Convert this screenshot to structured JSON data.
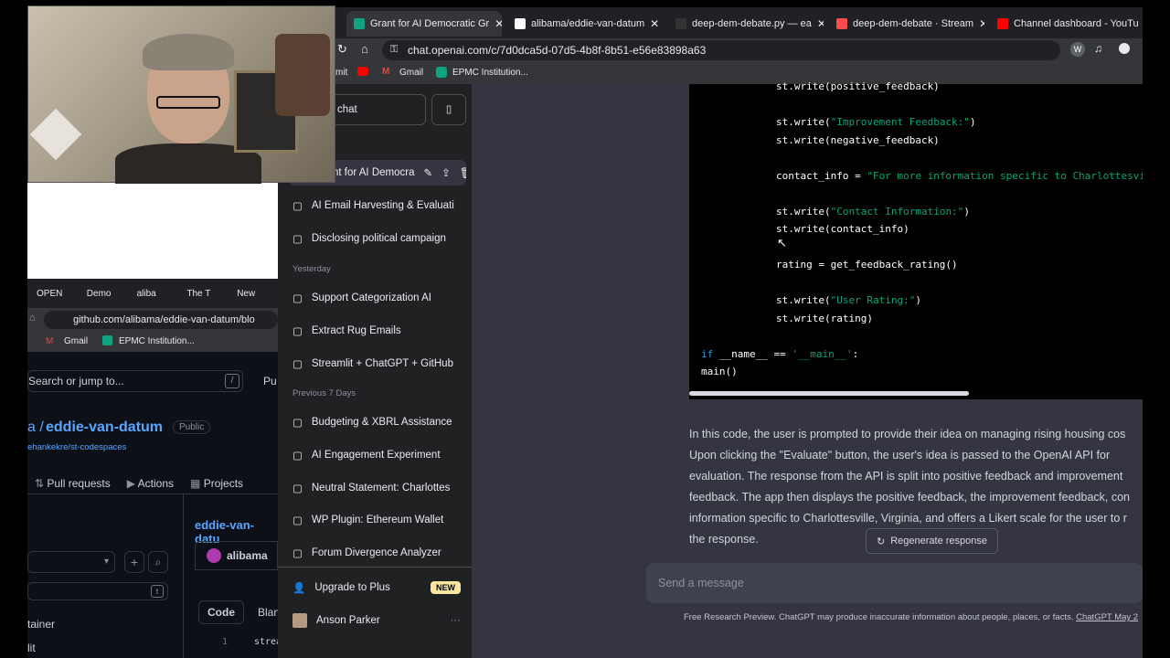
{
  "browser_tabs": [
    {
      "label": "Grant for AI Democratic Gr",
      "active": true,
      "color": "#10a37f"
    },
    {
      "label": "alibama/eddie-van-datum",
      "active": false,
      "color": "#ffffff"
    },
    {
      "label": "deep-dem-debate.py — ea",
      "active": false,
      "color": "#333333"
    },
    {
      "label": "deep-dem-debate · Stream",
      "active": false,
      "color": "#ff4b4b"
    },
    {
      "label": "Channel dashboard - YouTu",
      "active": false,
      "color": "#ff0000"
    }
  ],
  "url": "chat.openai.com/c/7d0dca5d-07d5-4b8f-8b51-e56e83898a63",
  "bookmarks": {
    "partial": "mit",
    "gmail": "Gmail",
    "epmc": "EPMC Institution..."
  },
  "sidebar": {
    "new_chat": "chat",
    "active_chat": "nt for AI Democra",
    "today_items": [
      "AI Email Harvesting & Evaluati",
      "Disclosing political campaign"
    ],
    "yesterday_header": "Yesterday",
    "yesterday_items": [
      "Support Categorization AI",
      "Extract Rug Emails",
      "Streamlit + ChatGPT + GitHub"
    ],
    "prev7_header": "Previous 7 Days",
    "prev7_items": [
      "Budgeting & XBRL Assistance",
      "AI Engagement Experiment",
      "Neutral Statement: Charlottes",
      "WP Plugin: Ethereum Wallet",
      "Forum Divergence Analyzer"
    ],
    "upgrade": "Upgrade to Plus",
    "new_badge": "NEW",
    "user": "Anson Parker"
  },
  "code_lines": [
    {
      "t": "    st.write(positive_feedback)"
    },
    {
      "t": "    st.write(",
      "s": "\"Improvement Feedback:\"",
      "e": ")"
    },
    {
      "t": "    st.write(negative_feedback)"
    },
    {
      "t": "    contact_info = ",
      "s": "\"For more information specific to Charlottesville",
      "e": ""
    },
    {
      "t": "    st.write(",
      "s": "\"Contact Information:\"",
      "e": ")"
    },
    {
      "t": "    st.write(contact_info)"
    },
    {
      "t": "    rating = get_feedback_rating()"
    },
    {
      "t": "    st.write(",
      "s": "\"User Rating:\"",
      "e": ")"
    },
    {
      "t": "    st.write(rating)"
    },
    {
      "k": "if",
      "t": " __name__ == ",
      "s": "'__main__'",
      "e": ":"
    },
    {
      "t": "    main()"
    }
  ],
  "explanation": [
    "In this code, the user is prompted to provide their idea on managing rising housing cos",
    "Upon clicking the \"Evaluate\" button, the user's idea is passed to the OpenAI API for",
    "evaluation. The response from the API is split into positive feedback and improvement",
    "feedback. The app then displays the positive feedback, the improvement feedback, con",
    "information specific to Charlottesville, Virginia, and offers a Likert scale for the user to r",
    "the response."
  ],
  "regenerate": "Regenerate response",
  "message_placeholder": "Send a message",
  "footer_text": "Free Research Preview. ChatGPT may produce inaccurate information about people, places, or facts.",
  "footer_link": "ChatGPT May 2",
  "github": {
    "tabs": [
      "OPEN",
      "Demo",
      "aliba",
      "The T",
      "New"
    ],
    "url": "github.com/alibama/eddie-van-datum/blo",
    "gmail": "Gmail",
    "epmc": "EPMC Institution...",
    "search": "Search or jump to...",
    "slash": "/",
    "pull": "Pu",
    "repo_owner": "a /",
    "repo_name": "eddie-van-datum",
    "visibility": "Public",
    "fork": "ehankekre/st-codespaces",
    "nav": [
      "Pull requests",
      "Actions",
      "Projects"
    ],
    "branch_link": "eddie-van-datu",
    "author": "alibama",
    "code_tab": "Code",
    "blame_tab": "Blan",
    "tree_item": "tainer",
    "tree_item2": "lit",
    "t_key": "t",
    "line_no": "1",
    "line_code": "streamlit"
  }
}
